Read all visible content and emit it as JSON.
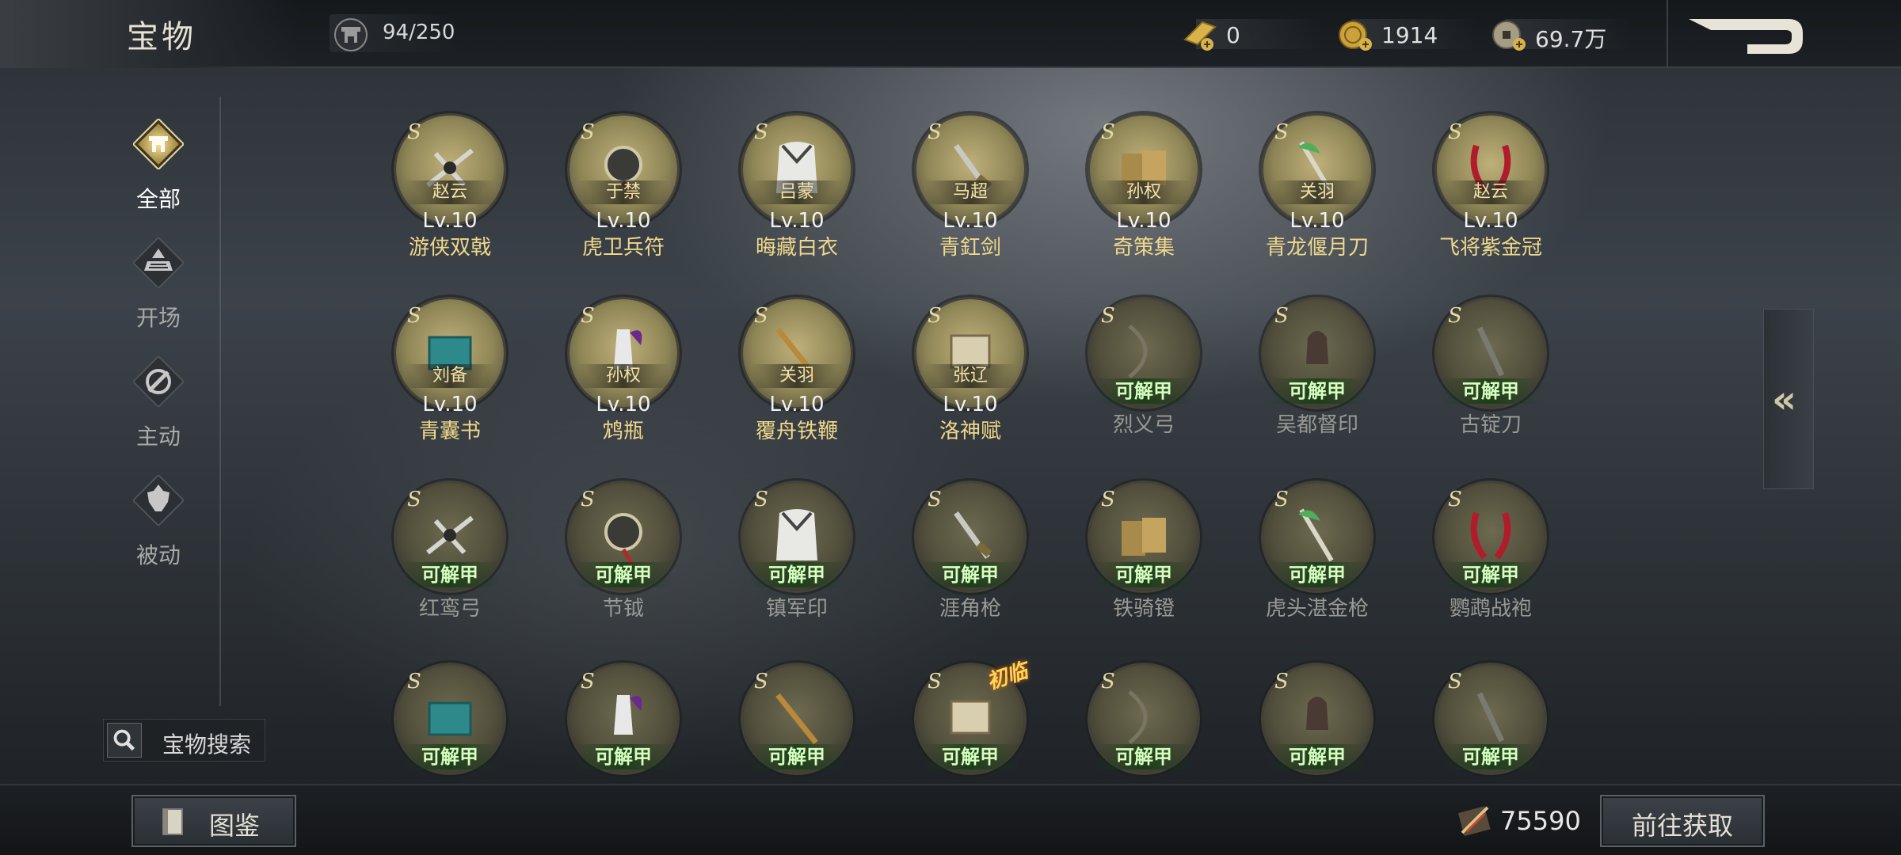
{
  "header": {
    "title": "宝物",
    "capacity": "94/250",
    "currencies": [
      {
        "icon": "gold-bar-icon",
        "value": "0"
      },
      {
        "icon": "gold-coin-icon",
        "value": "1914"
      },
      {
        "icon": "copper-coin-icon",
        "value": "69.7万"
      }
    ]
  },
  "sidebar": {
    "items": [
      {
        "label": "全部",
        "icon": "all-category-icon",
        "active": true
      },
      {
        "label": "开场",
        "icon": "opening-category-icon",
        "active": false
      },
      {
        "label": "主动",
        "icon": "active-category-icon",
        "active": false
      },
      {
        "label": "被动",
        "icon": "passive-category-icon",
        "active": false
      }
    ],
    "search_label": "宝物搜索"
  },
  "treasures": [
    {
      "owner": "赵云",
      "level": "Lv.10",
      "name": "游侠双戟",
      "unlocked": true
    },
    {
      "owner": "于禁",
      "level": "Lv.10",
      "name": "虎卫兵符",
      "unlocked": true
    },
    {
      "owner": "吕蒙",
      "level": "Lv.10",
      "name": "晦藏白衣",
      "unlocked": true
    },
    {
      "owner": "马超",
      "level": "Lv.10",
      "name": "青釭剑",
      "unlocked": true
    },
    {
      "owner": "孙权",
      "level": "Lv.10",
      "name": "奇策集",
      "unlocked": true
    },
    {
      "owner": "关羽",
      "level": "Lv.10",
      "name": "青龙偃月刀",
      "unlocked": true
    },
    {
      "owner": "赵云",
      "level": "Lv.10",
      "name": "飞将紫金冠",
      "unlocked": true
    },
    {
      "owner": "刘备",
      "level": "Lv.10",
      "name": "青囊书",
      "unlocked": true
    },
    {
      "owner": "孙权",
      "level": "Lv.10",
      "name": "鸩瓶",
      "unlocked": true
    },
    {
      "owner": "关羽",
      "level": "Lv.10",
      "name": "覆舟铁鞭",
      "unlocked": true
    },
    {
      "owner": "张辽",
      "level": "Lv.10",
      "name": "洛神赋",
      "unlocked": true
    },
    {
      "status": "可解甲",
      "name": "烈义弓",
      "unlocked": false
    },
    {
      "status": "可解甲",
      "name": "吴都督印",
      "unlocked": false
    },
    {
      "status": "可解甲",
      "name": "古锭刀",
      "unlocked": false
    },
    {
      "status": "可解甲",
      "name": "红鸾弓",
      "unlocked": false
    },
    {
      "status": "可解甲",
      "name": "节钺",
      "unlocked": false
    },
    {
      "status": "可解甲",
      "name": "镇军印",
      "unlocked": false
    },
    {
      "status": "可解甲",
      "name": "涯角枪",
      "unlocked": false
    },
    {
      "status": "可解甲",
      "name": "铁骑镫",
      "unlocked": false
    },
    {
      "status": "可解甲",
      "name": "虎头湛金枪",
      "unlocked": false
    },
    {
      "status": "可解甲",
      "name": "鹦鹉战袍",
      "unlocked": false
    },
    {
      "status": "可解甲",
      "unlocked": false
    },
    {
      "status": "可解甲",
      "unlocked": false
    },
    {
      "status": "可解甲",
      "unlocked": false
    },
    {
      "status": "可解甲",
      "badge": "初临",
      "unlocked": false
    },
    {
      "status": "可解甲",
      "unlocked": false
    },
    {
      "status": "可解甲",
      "unlocked": false
    },
    {
      "status": "可解甲",
      "unlocked": false
    }
  ],
  "rarity_mark": "S",
  "collapse_symbol": "«",
  "footer": {
    "codex_label": "图鉴",
    "material_count": "75590",
    "obtain_label": "前往获取"
  },
  "colors": {
    "accent_gold": "#f0d88a",
    "unlock_green": "#d5ffbf"
  }
}
